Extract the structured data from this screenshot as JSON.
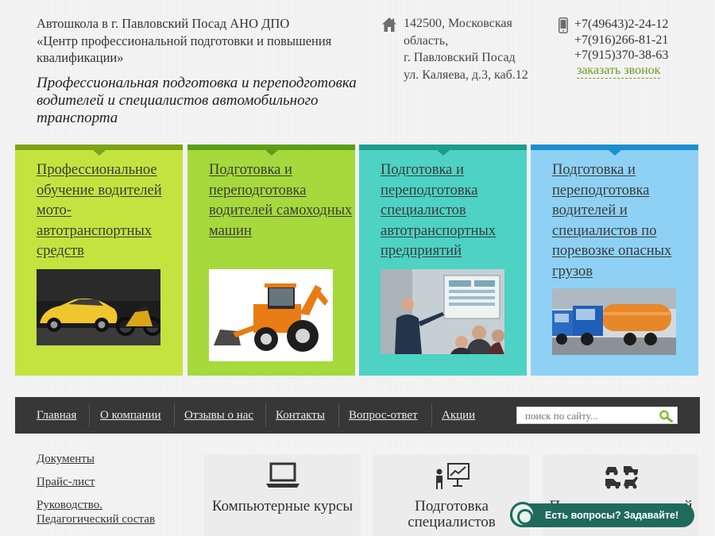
{
  "header": {
    "brand_line_1": "Автошкола в г. Павловский Посад АНО ДПО",
    "brand_line_2": "«Центр профессиональной подготовки и повышения",
    "brand_line_3": "квалификации»",
    "tagline": "Профессиональная подготовка и переподготовка водителей и специалистов автомобильного транспорта",
    "address": {
      "line_1": "142500, Московская",
      "line_2": "область,",
      "line_3": "г. Павловский Посад",
      "line_4": "ул. Каляева, д.3, каб.12",
      "icon": "home-icon"
    },
    "phones": [
      "+7(49643)2-24-12",
      "+7(916)266-81-21",
      "+7(915)370-38-63"
    ],
    "phone_icon": "mobile-phone-icon",
    "callback_label": "заказать звонок"
  },
  "tiles": [
    {
      "title": "Профессиональное обучение водителей мото-автотранспортных средств",
      "color": "#c4e33f",
      "image": "yellow sports car and motorcycle"
    },
    {
      "title": "Подготовка и переподготовка водителей самоходных машин",
      "color": "#a5d93c",
      "image": "orange backhoe loader"
    },
    {
      "title": "Подготовка и переподготовка специалистов автотранспортных предприятий",
      "color": "#4dd2c4",
      "image": "lecturer presenting to audience"
    },
    {
      "title": "Подготовка и переподготовка водителей и специалистов по поревозке опасных грузов",
      "color": "#8ed1f4",
      "image": "blue tanker trucks"
    }
  ],
  "nav": {
    "items": [
      "Главная",
      "О компании",
      "Отзывы о нас",
      "Контакты",
      "Вопрос-ответ",
      "Акции"
    ],
    "search_placeholder": "поиск по сайту..."
  },
  "sidebar": {
    "links": [
      "Документы",
      "Прайс-лист",
      "Руководство. Педагогический состав"
    ]
  },
  "cards": [
    {
      "label": "Компьютерные курсы",
      "icon": "laptop-icon"
    },
    {
      "label": "Подготовка специалистов",
      "icon": "presentation-icon"
    },
    {
      "label": "Подготовка водителей",
      "icon": "vehicles-icon"
    }
  ],
  "chat": {
    "label": "Есть вопросы? Задавайте!"
  }
}
